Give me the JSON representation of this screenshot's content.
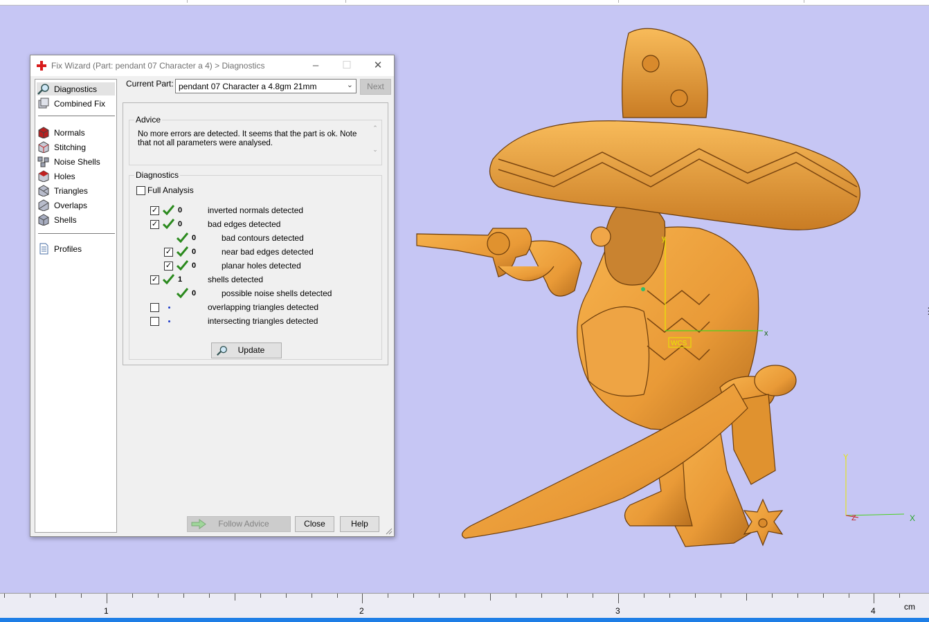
{
  "dialog": {
    "title": "Fix Wizard (Part: pendant 07 Character a 4) > Diagnostics",
    "controls": {
      "minimize": "–",
      "maximize": "☐",
      "close": "✕"
    }
  },
  "nav": {
    "items": [
      {
        "label": "Diagnostics",
        "icon": "magnifier-icon"
      },
      {
        "label": "Combined Fix",
        "icon": "combined-fix-icon"
      },
      {
        "label": "Normals",
        "icon": "normals-cube-icon"
      },
      {
        "label": "Stitching",
        "icon": "stitching-cube-icon"
      },
      {
        "label": "Noise Shells",
        "icon": "noise-shells-icon"
      },
      {
        "label": "Holes",
        "icon": "holes-cube-icon"
      },
      {
        "label": "Triangles",
        "icon": "triangles-cube-icon"
      },
      {
        "label": "Overlaps",
        "icon": "overlaps-cube-icon"
      },
      {
        "label": "Shells",
        "icon": "shells-cube-icon"
      },
      {
        "label": "Profiles",
        "icon": "document-icon"
      }
    ]
  },
  "current_part": {
    "label": "Current Part:",
    "value": "pendant 07 Character a 4.8gm 21mm",
    "next_label": "Next"
  },
  "advice": {
    "legend": "Advice",
    "line1": "No more errors are detected. It seems that the part is ok. Note",
    "line2": "that not all parameters were analysed."
  },
  "diagnostics": {
    "legend": "Diagnostics",
    "full_analysis": "Full Analysis",
    "rows": [
      {
        "checked": true,
        "status": "ok",
        "count": "0",
        "label": "inverted normals detected",
        "indent": 0
      },
      {
        "checked": true,
        "status": "ok",
        "count": "0",
        "label": "bad edges detected",
        "indent": 0
      },
      {
        "checked": null,
        "status": "ok",
        "count": "0",
        "label": "bad contours detected",
        "indent": 1
      },
      {
        "checked": true,
        "status": "ok",
        "count": "0",
        "label": "near bad edges detected",
        "indent": 1
      },
      {
        "checked": true,
        "status": "ok",
        "count": "0",
        "label": "planar holes detected",
        "indent": 1
      },
      {
        "checked": true,
        "status": "ok",
        "count": "1",
        "label": "shells detected",
        "indent": 0
      },
      {
        "checked": null,
        "status": "ok",
        "count": "0",
        "label": "possible noise shells detected",
        "indent": 1
      },
      {
        "checked": false,
        "status": "pending",
        "count": "",
        "label": "overlapping triangles detected",
        "indent": 0
      },
      {
        "checked": false,
        "status": "pending",
        "count": "",
        "label": "intersecting triangles detected",
        "indent": 0
      }
    ],
    "update_label": "Update"
  },
  "footer": {
    "follow_advice": "Follow Advice",
    "close": "Close",
    "help": "Help"
  },
  "viewport": {
    "axis_labels": {
      "y": "y",
      "x": "x",
      "wcs": "WCS"
    },
    "triad": {
      "y": "Y",
      "z": "Z",
      "x": "X"
    },
    "ruler": {
      "labels": [
        "1",
        "2",
        "3",
        "4"
      ],
      "unit": "cm"
    },
    "model_color": "#e99a37",
    "background": "#c6c6f4"
  }
}
